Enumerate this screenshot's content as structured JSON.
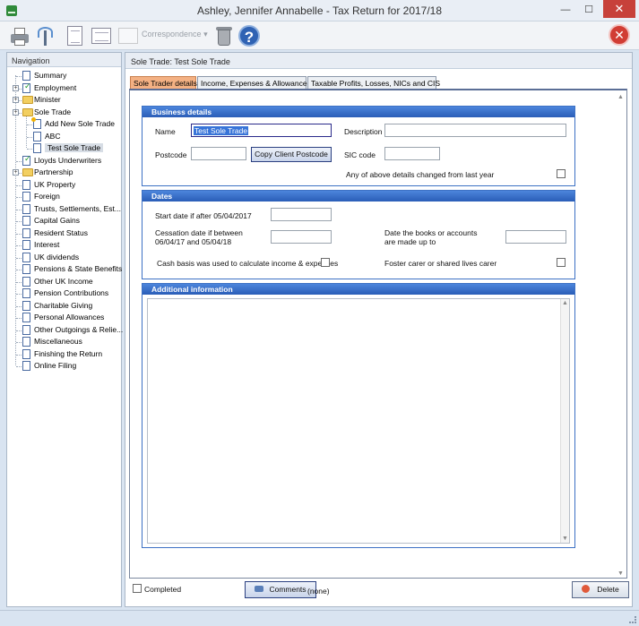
{
  "window": {
    "title": "Ashley, Jennifer Annabelle - Tax Return for 2017/18",
    "min_glyph": "—",
    "max_glyph": "☐",
    "close_glyph": "✕"
  },
  "toolbar": {
    "correspondence_label": "Correspondence",
    "correspondence_arrow": "▾",
    "help_glyph": "?",
    "exit_glyph": "✕"
  },
  "nav": {
    "header": "Navigation",
    "items": [
      {
        "label": "Summary",
        "icon": "document-icon"
      },
      {
        "label": "Employment",
        "icon": "checked-document-icon"
      },
      {
        "label": "Minister",
        "icon": "folder-icon"
      },
      {
        "label": "Sole Trade",
        "icon": "folder-icon"
      },
      {
        "label": "Add New Sole Trade",
        "icon": "new-document-icon"
      },
      {
        "label": "ABC",
        "icon": "document-icon"
      },
      {
        "label": "Test Sole Trade",
        "icon": "document-icon",
        "selected": true
      },
      {
        "label": "Lloyds Underwriters",
        "icon": "checked-document-icon"
      },
      {
        "label": "Partnership",
        "icon": "folder-icon"
      },
      {
        "label": "UK Property",
        "icon": "document-icon"
      },
      {
        "label": "Foreign",
        "icon": "document-icon"
      },
      {
        "label": "Trusts, Settlements, Est...",
        "icon": "document-icon"
      },
      {
        "label": "Capital Gains",
        "icon": "document-icon"
      },
      {
        "label": "Resident Status",
        "icon": "document-icon"
      },
      {
        "label": "Interest",
        "icon": "document-icon"
      },
      {
        "label": "UK dividends",
        "icon": "document-icon"
      },
      {
        "label": "Pensions & State Benefits",
        "icon": "document-icon"
      },
      {
        "label": "Other UK Income",
        "icon": "document-icon"
      },
      {
        "label": "Pension Contributions",
        "icon": "document-icon"
      },
      {
        "label": "Charitable Giving",
        "icon": "document-icon"
      },
      {
        "label": "Personal Allowances",
        "icon": "document-icon"
      },
      {
        "label": "Other Outgoings & Relie...",
        "icon": "document-icon"
      },
      {
        "label": "Miscellaneous",
        "icon": "document-icon"
      },
      {
        "label": "Finishing the Return",
        "icon": "document-icon"
      },
      {
        "label": "Online Filing",
        "icon": "document-icon"
      }
    ]
  },
  "content": {
    "header": "Sole Trade: Test Sole Trade",
    "tabs": [
      "Sole Trader details",
      "Income, Expenses & Allowances",
      "Taxable Profits, Losses, NICs and CIS"
    ],
    "business": {
      "title": "Business details",
      "name_label": "Name",
      "name_value": "Test Sole Trade",
      "description_label": "Description",
      "description_value": "",
      "postcode_label": "Postcode",
      "postcode_value": "",
      "copy_postcode_button": "Copy Client Postcode",
      "sic_label": "SIC code",
      "sic_value": "",
      "changed_label": "Any of above details changed from last year"
    },
    "dates": {
      "title": "Dates",
      "start_label": "Start date if after 05/04/2017",
      "cessation_label_1": "Cessation date if between",
      "cessation_label_2": "06/04/17 and 05/04/18",
      "books_label_1": "Date the books or accounts",
      "books_label_2": "are made up to",
      "cash_basis_label": "Cash basis was used to calculate income & expenses",
      "foster_label": "Foster carer or shared lives carer"
    },
    "additional": {
      "title": "Additional information"
    },
    "scroll_up": "▲",
    "scroll_down": "▼",
    "footer": {
      "completed_label": "Completed",
      "comments_button": "Comments",
      "comments_value": "(none)",
      "delete_button": "Delete"
    }
  }
}
